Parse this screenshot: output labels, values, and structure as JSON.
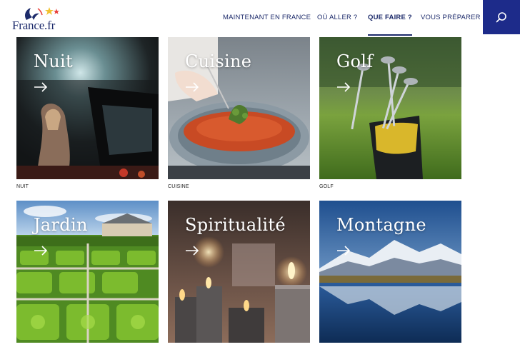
{
  "header": {
    "logo_text": "France.fr",
    "nav": [
      {
        "label": "MAINTENANT EN FRANCE",
        "active": false
      },
      {
        "label": "OÙ ALLER ?",
        "active": false
      },
      {
        "label": "QUE FAIRE ?",
        "active": true
      },
      {
        "label": "VOUS PRÉPARER",
        "active": false
      }
    ],
    "search_icon": "search-icon"
  },
  "colors": {
    "brand_navy": "#1d2b6b",
    "search_bg": "#1d2b8a",
    "logo_star_red": "#e8413c",
    "logo_star_yellow": "#f2c230"
  },
  "cards": [
    {
      "title": "Nuit",
      "caption": "NUIT",
      "icon": "arrow-right-icon"
    },
    {
      "title": "Cuisine",
      "caption": "CUISINE",
      "icon": "arrow-right-icon"
    },
    {
      "title": "Golf",
      "caption": "GOLF",
      "icon": "arrow-right-icon"
    },
    {
      "title": "Jardin",
      "caption": "",
      "icon": "arrow-right-icon"
    },
    {
      "title": "Spiritualité",
      "caption": "",
      "icon": "arrow-right-icon"
    },
    {
      "title": "Montagne",
      "caption": "",
      "icon": "arrow-right-icon"
    }
  ]
}
